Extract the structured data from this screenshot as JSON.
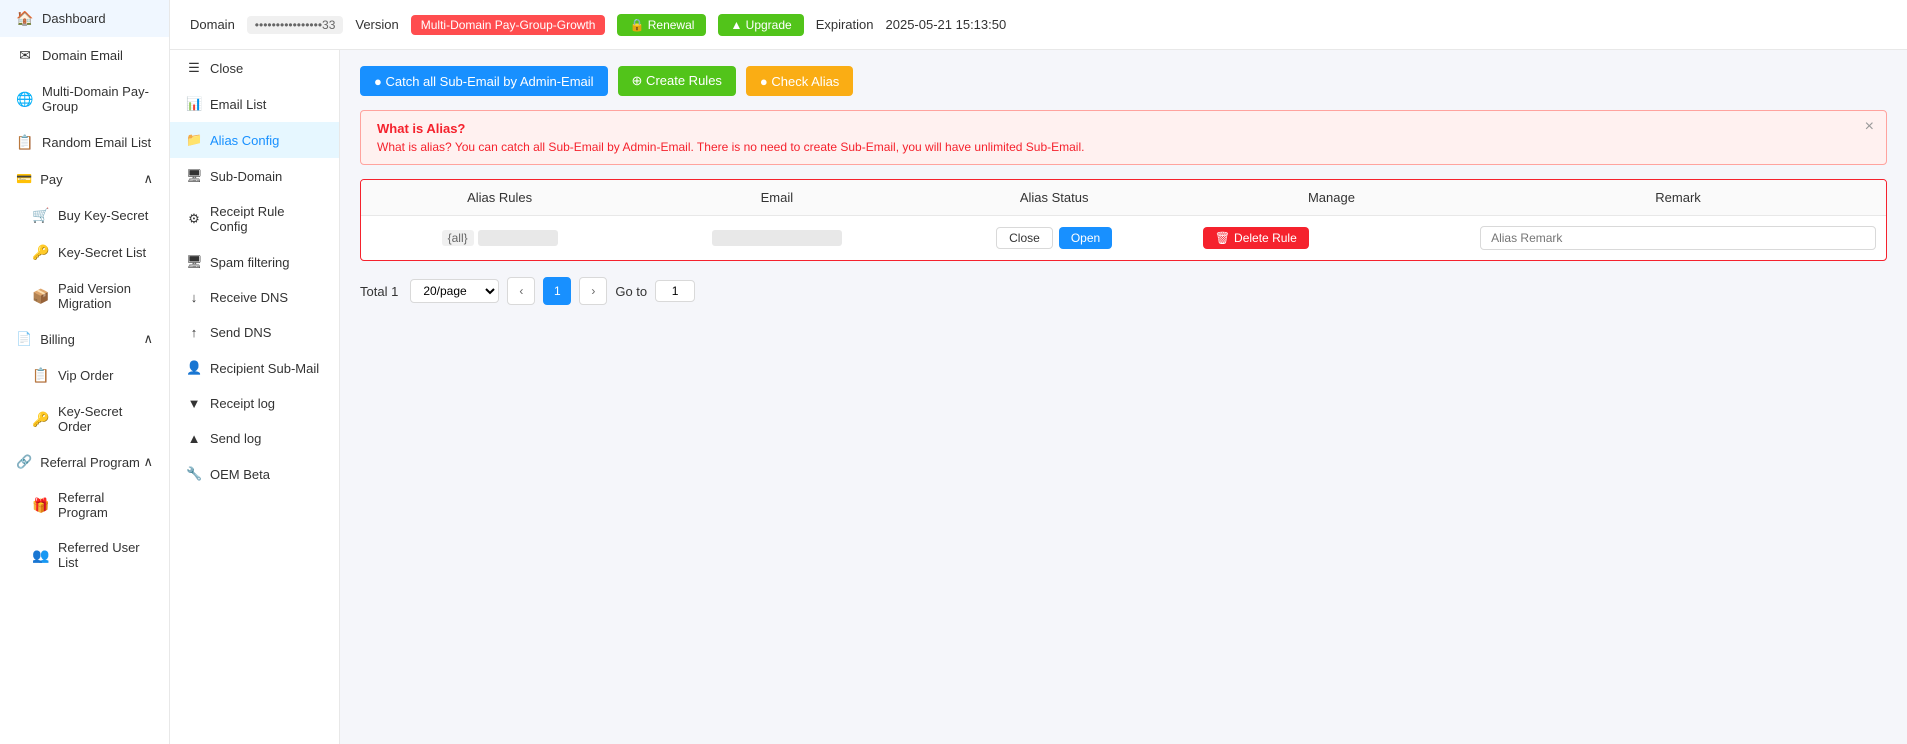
{
  "sidebar": {
    "items": [
      {
        "label": "Dashboard",
        "icon": "🏠",
        "name": "sidebar-item-dashboard"
      },
      {
        "label": "Domain Email",
        "icon": "✉",
        "name": "sidebar-item-domain-email"
      },
      {
        "label": "Multi-Domain Pay-Group",
        "icon": "🌐",
        "name": "sidebar-item-multi-domain"
      },
      {
        "label": "Random Email List",
        "icon": "📋",
        "name": "sidebar-item-random-email"
      },
      {
        "label": "Pay",
        "icon": "💳",
        "name": "sidebar-item-pay",
        "expandable": true
      },
      {
        "label": "Buy Key-Secret",
        "icon": "🛒",
        "name": "sidebar-item-buy-key"
      },
      {
        "label": "Key-Secret List",
        "icon": "🔑",
        "name": "sidebar-item-key-list"
      },
      {
        "label": "Paid Version Migration",
        "icon": "📦",
        "name": "sidebar-item-paid-migration"
      },
      {
        "label": "Billing",
        "icon": "📄",
        "name": "sidebar-item-billing",
        "expandable": true
      },
      {
        "label": "Vip Order",
        "icon": "📋",
        "name": "sidebar-item-vip-order"
      },
      {
        "label": "Key-Secret Order",
        "icon": "🔑",
        "name": "sidebar-item-key-order"
      },
      {
        "label": "Referral Program",
        "icon": "🔗",
        "name": "sidebar-item-referral",
        "expandable": true
      },
      {
        "label": "Referral Program",
        "icon": "🎁",
        "name": "sidebar-item-referral-program"
      },
      {
        "label": "Referred User List",
        "icon": "👥",
        "name": "sidebar-item-referred-users"
      }
    ]
  },
  "header": {
    "domain_label": "Domain",
    "domain_value": "••••••••••••••••33",
    "version_label": "Version",
    "version_badge": "Multi-Domain Pay-Group-Growth",
    "renewal_label": "🔒 Renewal",
    "upgrade_label": "▲ Upgrade",
    "expiration_label": "Expiration",
    "expiration_value": "2025-05-21 15:13:50"
  },
  "left_panel": {
    "items": [
      {
        "label": "Close",
        "icon": "☰",
        "name": "left-panel-close"
      },
      {
        "label": "Email List",
        "icon": "📊",
        "name": "left-panel-email-list"
      },
      {
        "label": "Alias Config",
        "icon": "📁",
        "name": "left-panel-alias-config",
        "active": true
      },
      {
        "label": "Sub-Domain",
        "icon": "🖥",
        "name": "left-panel-sub-domain"
      },
      {
        "label": "Receipt Rule Config",
        "icon": "⚙",
        "name": "left-panel-receipt-rule"
      },
      {
        "label": "Spam filtering",
        "icon": "🖥",
        "name": "left-panel-spam"
      },
      {
        "label": "Receive DNS",
        "icon": "↓",
        "name": "left-panel-receive-dns"
      },
      {
        "label": "Send DNS",
        "icon": "↑",
        "name": "left-panel-send-dns"
      },
      {
        "label": "Recipient Sub-Mail",
        "icon": "👤",
        "name": "left-panel-recipient"
      },
      {
        "label": "Receipt log",
        "icon": "▼",
        "name": "left-panel-receipt-log"
      },
      {
        "label": "Send log",
        "icon": "▲",
        "name": "left-panel-send-log"
      },
      {
        "label": "OEM Beta",
        "icon": "🔧",
        "name": "left-panel-oem"
      }
    ]
  },
  "action_buttons": {
    "catch_label": "● Catch all Sub-Email by Admin-Email",
    "create_label": "⊕ Create Rules",
    "check_label": "● Check Alias"
  },
  "info_alert": {
    "title": "What is Alias?",
    "body": "What is alias? You can catch all Sub-Email by Admin-Email. There is no need to create Sub-Email, you will have unlimited Sub-Email."
  },
  "table": {
    "columns": [
      "Alias Rules",
      "Email",
      "Alias Status",
      "Manage",
      "Remark"
    ],
    "rows": [
      {
        "alias_rules_prefix": "{all}",
        "alias_rules_suffix": "••••••••••••••",
        "email": "••••••••••••••••",
        "status_close": "Close",
        "status_open": "Open",
        "delete_label": "Delete Rule",
        "remark_placeholder": "Alias Remark"
      }
    ]
  },
  "pagination": {
    "total_label": "Total",
    "total_count": "1",
    "per_page": "20/page",
    "current_page": "1",
    "goto_label": "Go to",
    "goto_value": "1"
  }
}
